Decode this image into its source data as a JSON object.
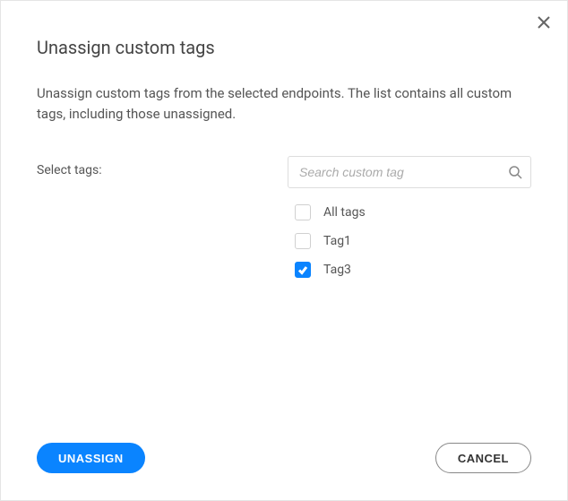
{
  "dialog": {
    "title": "Unassign custom tags",
    "description": "Unassign custom tags from the selected endpoints. The list contains all custom tags, including those unassigned.",
    "select_label": "Select tags:",
    "search": {
      "placeholder": "Search custom tag"
    },
    "tags": [
      {
        "label": "All tags",
        "checked": false
      },
      {
        "label": "Tag1",
        "checked": false
      },
      {
        "label": "Tag3",
        "checked": true
      }
    ],
    "buttons": {
      "primary": "UNASSIGN",
      "secondary": "CANCEL"
    }
  }
}
